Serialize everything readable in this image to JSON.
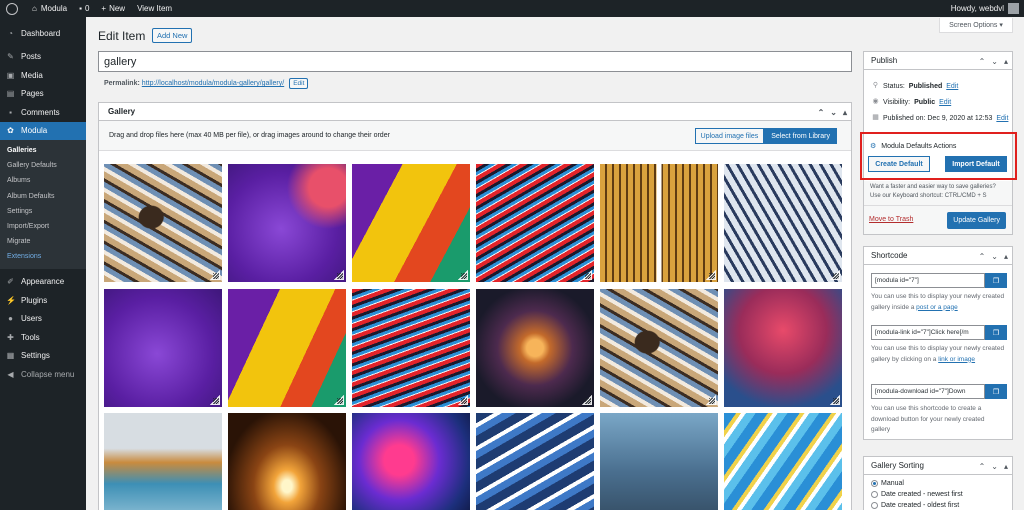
{
  "admin_bar": {
    "site_name": "Modula",
    "comments_count": "0",
    "new_label": "New",
    "view_item": "View Item",
    "howdy": "Howdy, webdvl"
  },
  "sidebar": {
    "items_top": [
      {
        "label": "Dashboard",
        "icon": "dashboard-icon"
      },
      {
        "label": "Posts",
        "icon": "pin-icon"
      },
      {
        "label": "Media",
        "icon": "media-icon"
      },
      {
        "label": "Pages",
        "icon": "page-icon"
      },
      {
        "label": "Comments",
        "icon": "comment-icon"
      }
    ],
    "active": {
      "label": "Modula",
      "icon": "modula-icon"
    },
    "submenu": [
      "Galleries",
      "Gallery Defaults",
      "Albums",
      "Album Defaults",
      "Settings",
      "Import/Export",
      "Migrate",
      "Extensions"
    ],
    "items_bottom": [
      {
        "label": "Appearance",
        "icon": "brush-icon"
      },
      {
        "label": "Plugins",
        "icon": "plug-icon"
      },
      {
        "label": "Users",
        "icon": "user-icon"
      },
      {
        "label": "Tools",
        "icon": "wrench-icon"
      },
      {
        "label": "Settings",
        "icon": "settings-icon"
      },
      {
        "label": "Collapse menu",
        "icon": "collapse-icon"
      }
    ]
  },
  "screen_options": "Screen Options ▾",
  "page": {
    "title": "Edit Item",
    "add_new": "Add New",
    "post_title": "gallery",
    "permalink_label": "Permalink:",
    "permalink_url": "http://localhost/modula/modula-gallery/gallery/",
    "permalink_edit": "Edit"
  },
  "gallery": {
    "header": "Gallery",
    "drag_text": "Drag and drop files here (max 40 MB per file), or drag images around to change their order",
    "upload_btn": "Upload image files",
    "library_btn": "Select from Library"
  },
  "publish": {
    "header": "Publish",
    "status_label": "Status:",
    "status_value": "Published",
    "visibility_label": "Visibility:",
    "visibility_value": "Public",
    "published_on": "Published on: Dec 9, 2020 at 12:53",
    "edit": "Edit",
    "modula_defaults": "Modula Defaults Actions",
    "create_default": "Create Default",
    "import_default": "Import Default",
    "hint_line1": "Want a faster and easier way to save galleries?",
    "hint_line2": "Use our Keyboard shortcut: CTRL/CMD + S",
    "move_to_trash": "Move to Trash",
    "update": "Update Gallery"
  },
  "shortcode": {
    "header": "Shortcode",
    "sc1": "[modula id=\"7\"]",
    "help1a": "You can use this to display your newly created gallery inside a ",
    "help1_link": "post or a page",
    "sc2": "[modula-link id=\"7\"]Click here[/m",
    "help2a": "You can use this to display your newly created gallery by clicking on a ",
    "help2_link": "link or image",
    "sc3": "[modula-download id=\"7\"]Down",
    "help3": "You can use this shortcode to create a download button for your newly created gallery"
  },
  "sorting": {
    "header": "Gallery Sorting",
    "options": [
      "Manual",
      "Date created - newest first",
      "Date created - oldest first"
    ],
    "selected": "Manual"
  },
  "colors": {
    "accent": "#2271b1",
    "admin_dark": "#1d2327",
    "highlight_border": "#e0201e"
  }
}
